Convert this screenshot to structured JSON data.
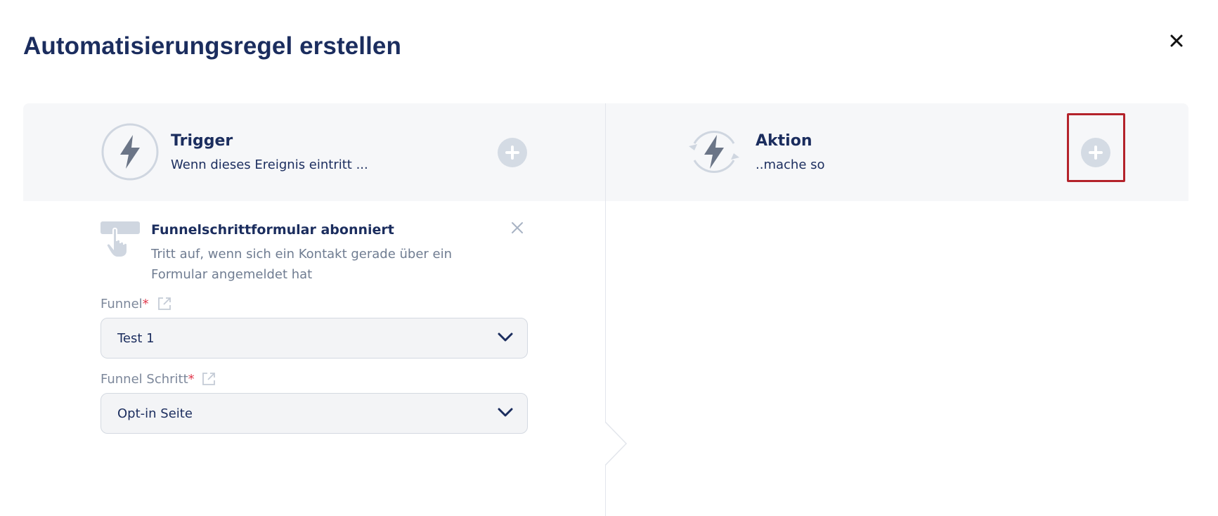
{
  "modal": {
    "title": "Automatisierungsregel erstellen"
  },
  "trigger": {
    "title": "Trigger",
    "subtitle": "Wenn dieses Ereignis eintritt ..."
  },
  "action": {
    "title": "Aktion",
    "subtitle": "..mache so"
  },
  "selected_trigger": {
    "title": "Funnelschrittformular abonniert",
    "description": "Tritt auf, wenn sich ein Kontakt gerade über ein Formular angemeldet hat"
  },
  "fields": {
    "funnel": {
      "label": "Funnel",
      "required_mark": "*",
      "value": "Test 1"
    },
    "funnel_step": {
      "label": "Funnel Schritt",
      "required_mark": "*",
      "value": "Opt-in Seite"
    }
  },
  "colors": {
    "navy": "#1b2d5e",
    "highlight": "#b4232b",
    "band": "#f6f7f9",
    "plus": "#d4dbe4"
  },
  "icons": {
    "close": "close-icon",
    "trigger": "lightning-icon",
    "action": "lightning-refresh-icon",
    "add": "plus-icon",
    "hand": "hand-pointer-icon",
    "external": "external-link-icon",
    "chevron": "chevron-down-icon"
  }
}
